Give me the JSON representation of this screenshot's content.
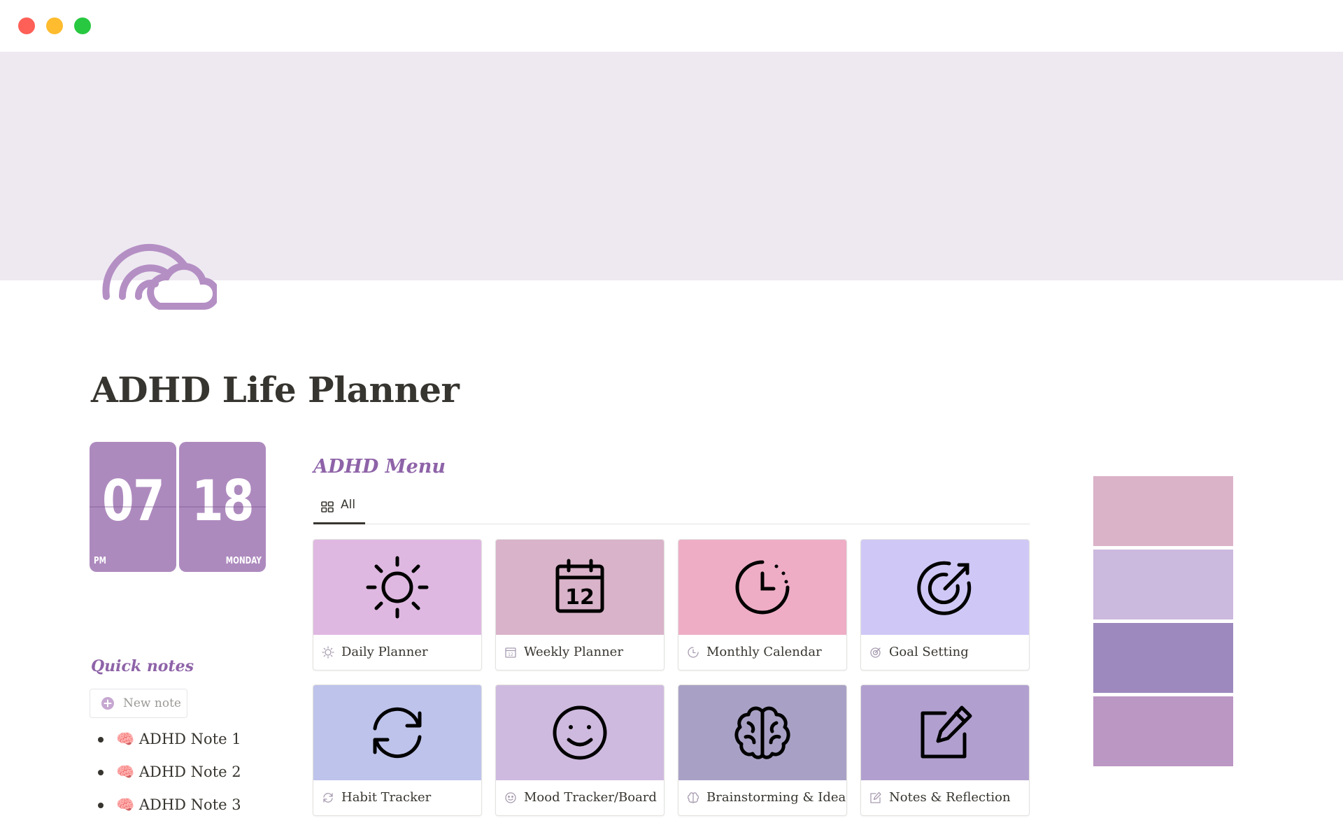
{
  "window": {
    "controls": [
      "close",
      "minimize",
      "maximize"
    ]
  },
  "colors": {
    "cover": "#eee9f1",
    "accent": "#8e63a8",
    "clock": "#ad8abe",
    "page_icon": "#b48fc4"
  },
  "page": {
    "icon": "rainbow-cloud-icon",
    "title": "ADHD Life Planner"
  },
  "clock": {
    "hour": "07",
    "minute": "18",
    "period": "PM",
    "weekday": "MONDAY"
  },
  "menu": {
    "heading": "ADHD Menu",
    "tabs": [
      {
        "label": "All",
        "icon": "gallery-grid-icon",
        "active": true
      }
    ],
    "cards": [
      {
        "label": "Daily Planner",
        "icon": "sun-icon",
        "color": "#dfb8e1"
      },
      {
        "label": "Weekly Planner",
        "icon": "calendar-12-icon",
        "color": "#d9b3c9"
      },
      {
        "label": "Monthly Calendar",
        "icon": "clock-icon",
        "color": "#eeadc5"
      },
      {
        "label": "Goal Setting",
        "icon": "target-icon",
        "color": "#cfc8f6"
      },
      {
        "label": "Habit Tracker",
        "icon": "refresh-icon",
        "color": "#bec3eb"
      },
      {
        "label": "Mood Tracker/Board",
        "icon": "smile-icon",
        "color": "#cfbadf"
      },
      {
        "label": "Brainstorming & Ideas",
        "icon": "brain-icon",
        "color": "#a9a1c5"
      },
      {
        "label": "Notes & Reflection",
        "icon": "edit-note-icon",
        "color": "#b1a0cf"
      }
    ]
  },
  "quick_notes": {
    "heading": "Quick notes",
    "new_note_label": "New note",
    "items": [
      {
        "emoji": "🧠",
        "label": "ADHD Note 1"
      },
      {
        "emoji": "🧠",
        "label": "ADHD Note 2"
      },
      {
        "emoji": "🧠",
        "label": "ADHD Note 3"
      }
    ]
  },
  "palette": [
    "#dbb3c8",
    "#ccb9de",
    "#9d89bd",
    "#bb97c4"
  ]
}
